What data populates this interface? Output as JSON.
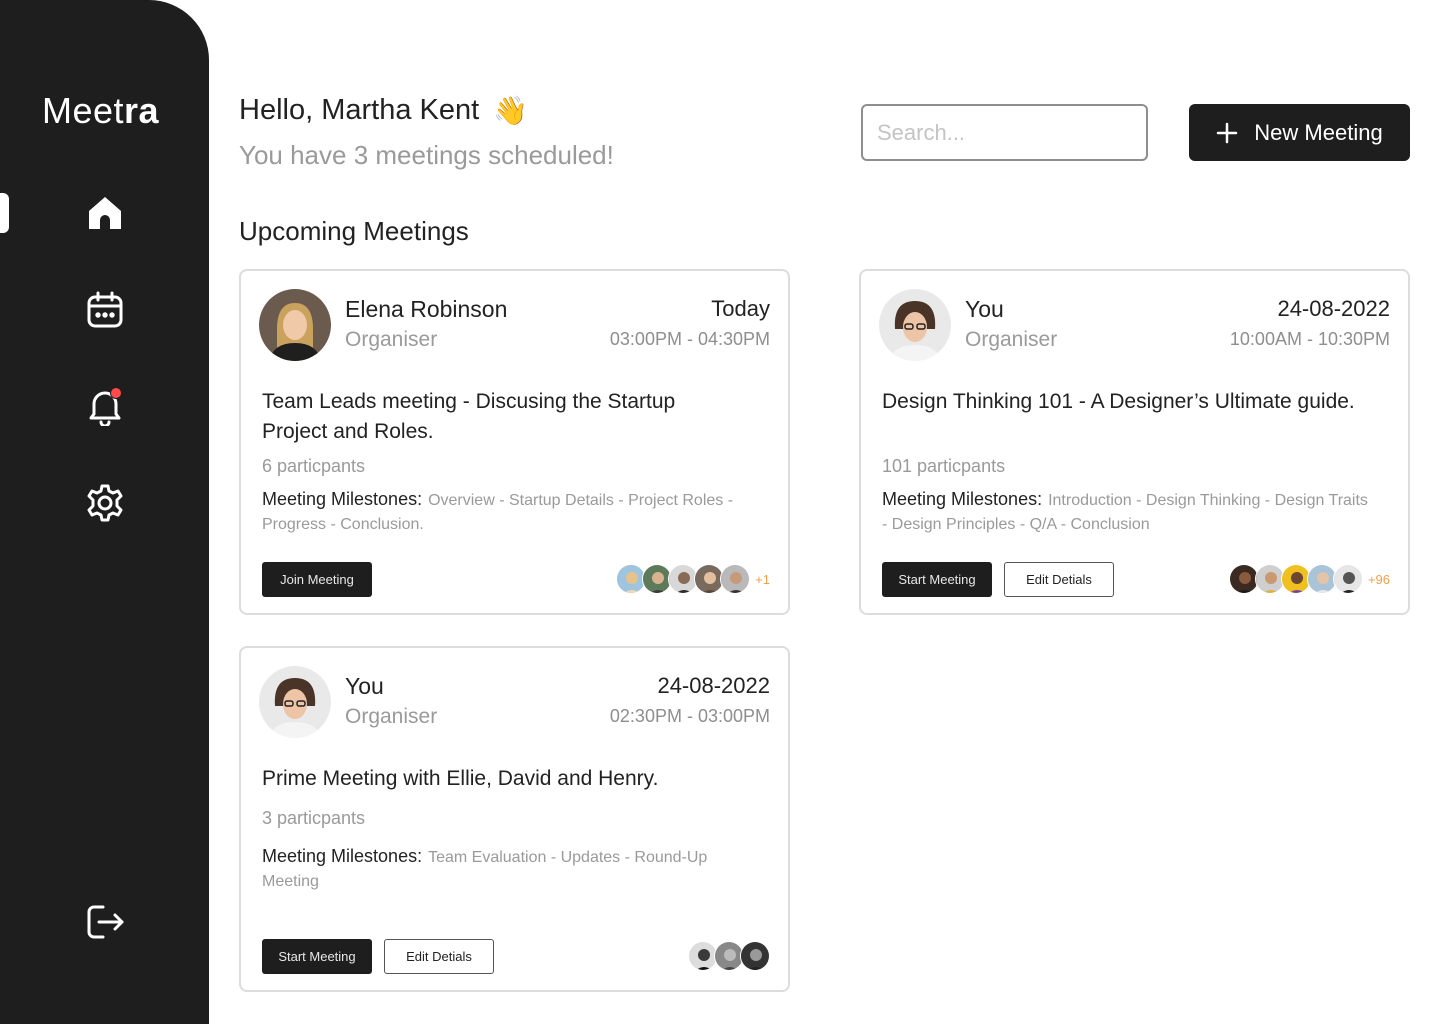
{
  "app": {
    "logo_light": "Meet",
    "logo_bold": "ra"
  },
  "sidebar": {
    "items": [
      {
        "icon": "home-icon",
        "active": true
      },
      {
        "icon": "calendar-icon",
        "active": false
      },
      {
        "icon": "bell-icon",
        "active": false,
        "has_notification": true
      },
      {
        "icon": "settings-icon",
        "active": false
      },
      {
        "icon": "logout-icon",
        "active": false
      }
    ]
  },
  "header": {
    "greeting": "Hello, Martha Kent",
    "wave_emoji": "👋",
    "subtitle": "You have 3 meetings scheduled!",
    "search_placeholder": "Search...",
    "new_meeting_label": "New Meeting"
  },
  "section": {
    "title": "Upcoming Meetings"
  },
  "colors": {
    "sidebar_bg": "#1e1e1e",
    "accent_more": "#f0a04b",
    "notification": "#ff4a4a"
  },
  "meetings": [
    {
      "organiser": "Elena Robinson",
      "role": "Organiser",
      "date": "Today",
      "time": "03:00PM - 04:30PM",
      "title": "Team Leads meeting - Discusing the Startup Project and Roles.",
      "participants": "6 particpants",
      "milestones_label": "Meeting Milestones:",
      "milestones": "Overview - Startup Details - Project Roles - Progress - Conclusion.",
      "primary_button": "Join Meeting",
      "secondary_button": "",
      "more_count": "+1"
    },
    {
      "organiser": "You",
      "role": "Organiser",
      "date": "24-08-2022",
      "time": "10:00AM - 10:30PM",
      "title": "Design Thinking 101 - A Designer’s Ultimate guide.",
      "participants": "101 particpants",
      "milestones_label": "Meeting Milestones:",
      "milestones": "Introduction - Design Thinking - Design Traits - Design Principles - Q/A - Conclusion",
      "primary_button": "Start Meeting",
      "secondary_button": "Edit Detials",
      "more_count": "+96"
    },
    {
      "organiser": "You",
      "role": "Organiser",
      "date": "24-08-2022",
      "time": "02:30PM - 03:00PM",
      "title": "Prime Meeting with Ellie, David and Henry.",
      "participants": "3 particpants",
      "milestones_label": "Meeting Milestones:",
      "milestones": "Team Evaluation - Updates - Round-Up Meeting",
      "primary_button": "Start Meeting",
      "secondary_button": "Edit Detials",
      "more_count": ""
    }
  ]
}
